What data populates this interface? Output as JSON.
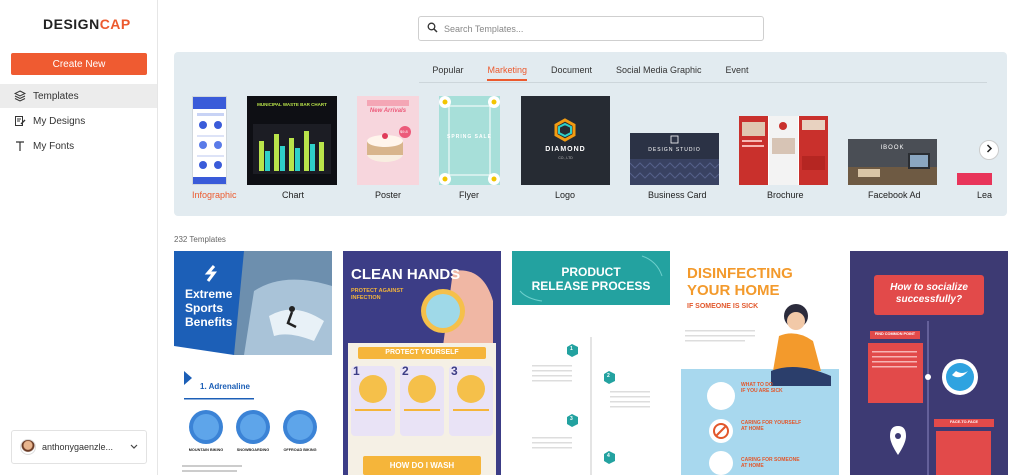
{
  "app": {
    "logo_main": "DESIGN",
    "logo_accent": "CAP",
    "create_label": "Create New"
  },
  "nav": {
    "items": [
      {
        "label": "Templates",
        "icon": "layers-icon"
      },
      {
        "label": "My Designs",
        "icon": "edit-document-icon"
      },
      {
        "label": "My Fonts",
        "icon": "text-t-icon"
      }
    ]
  },
  "user": {
    "name": "anthonygaenzle..."
  },
  "search": {
    "placeholder": "Search Templates..."
  },
  "tabs": [
    "Popular",
    "Marketing",
    "Document",
    "Social Media Graphic",
    "Event"
  ],
  "categories": [
    "Infographic",
    "Chart",
    "Poster",
    "Flyer",
    "Logo",
    "Business Card",
    "Brochure",
    "Facebook Ad",
    "Lea"
  ],
  "thumb_text": {
    "chart_title": "MUNICIPAL WASTE BAR CHART",
    "poster_title": "New Arrivals",
    "poster_price": "$9.8",
    "flyer_title": "SPRING SALE",
    "logo_name": "DIAMOND",
    "logo_sub": "CO., LTD",
    "card_name": "DESIGN STUDIO",
    "fb_title": "IBOOK"
  },
  "count_label": "232 Templates",
  "cards": {
    "c1": {
      "title1": "Extreme",
      "title2": "Sports",
      "title3": "Benefits",
      "section": "1. Adrenaline",
      "labels": [
        "MOUNTAIN BIKING",
        "SNOWBOARDING",
        "OFFROAD BIKING"
      ]
    },
    "c2": {
      "title": "CLEAN HANDS",
      "sub1": "PROTECT AGAINST",
      "sub2": "INFECTION",
      "banner": "PROTECT YOURSELF",
      "steps": [
        "1",
        "2",
        "3"
      ],
      "bottom": "HOW DO I WASH"
    },
    "c3": {
      "title1": "PRODUCT",
      "title2": "RELEASE PROCESS",
      "nodes": [
        "1",
        "2",
        "3",
        "4"
      ]
    },
    "c4": {
      "title1": "DISINFECTING",
      "title2": "YOUR HOME",
      "sub": "IF SOMEONE IS SICK",
      "h1": "WHAT TO DO",
      "h1b": "IF YOU ARE SICK",
      "h2": "CARING FOR YOURSELF",
      "h2b": "AT HOME",
      "h3": "CARING FOR SOMEONE",
      "h3b": "AT HOME"
    },
    "c5": {
      "title1": "How to socialize",
      "title2": "successfully?",
      "tag1": "FIND COMMON POINT",
      "tag2": "FACE-TO-FACE"
    }
  },
  "colors": {
    "accent": "#ef5b31",
    "panel": "#e2ebf0",
    "sidebar_active": "#ececec"
  }
}
